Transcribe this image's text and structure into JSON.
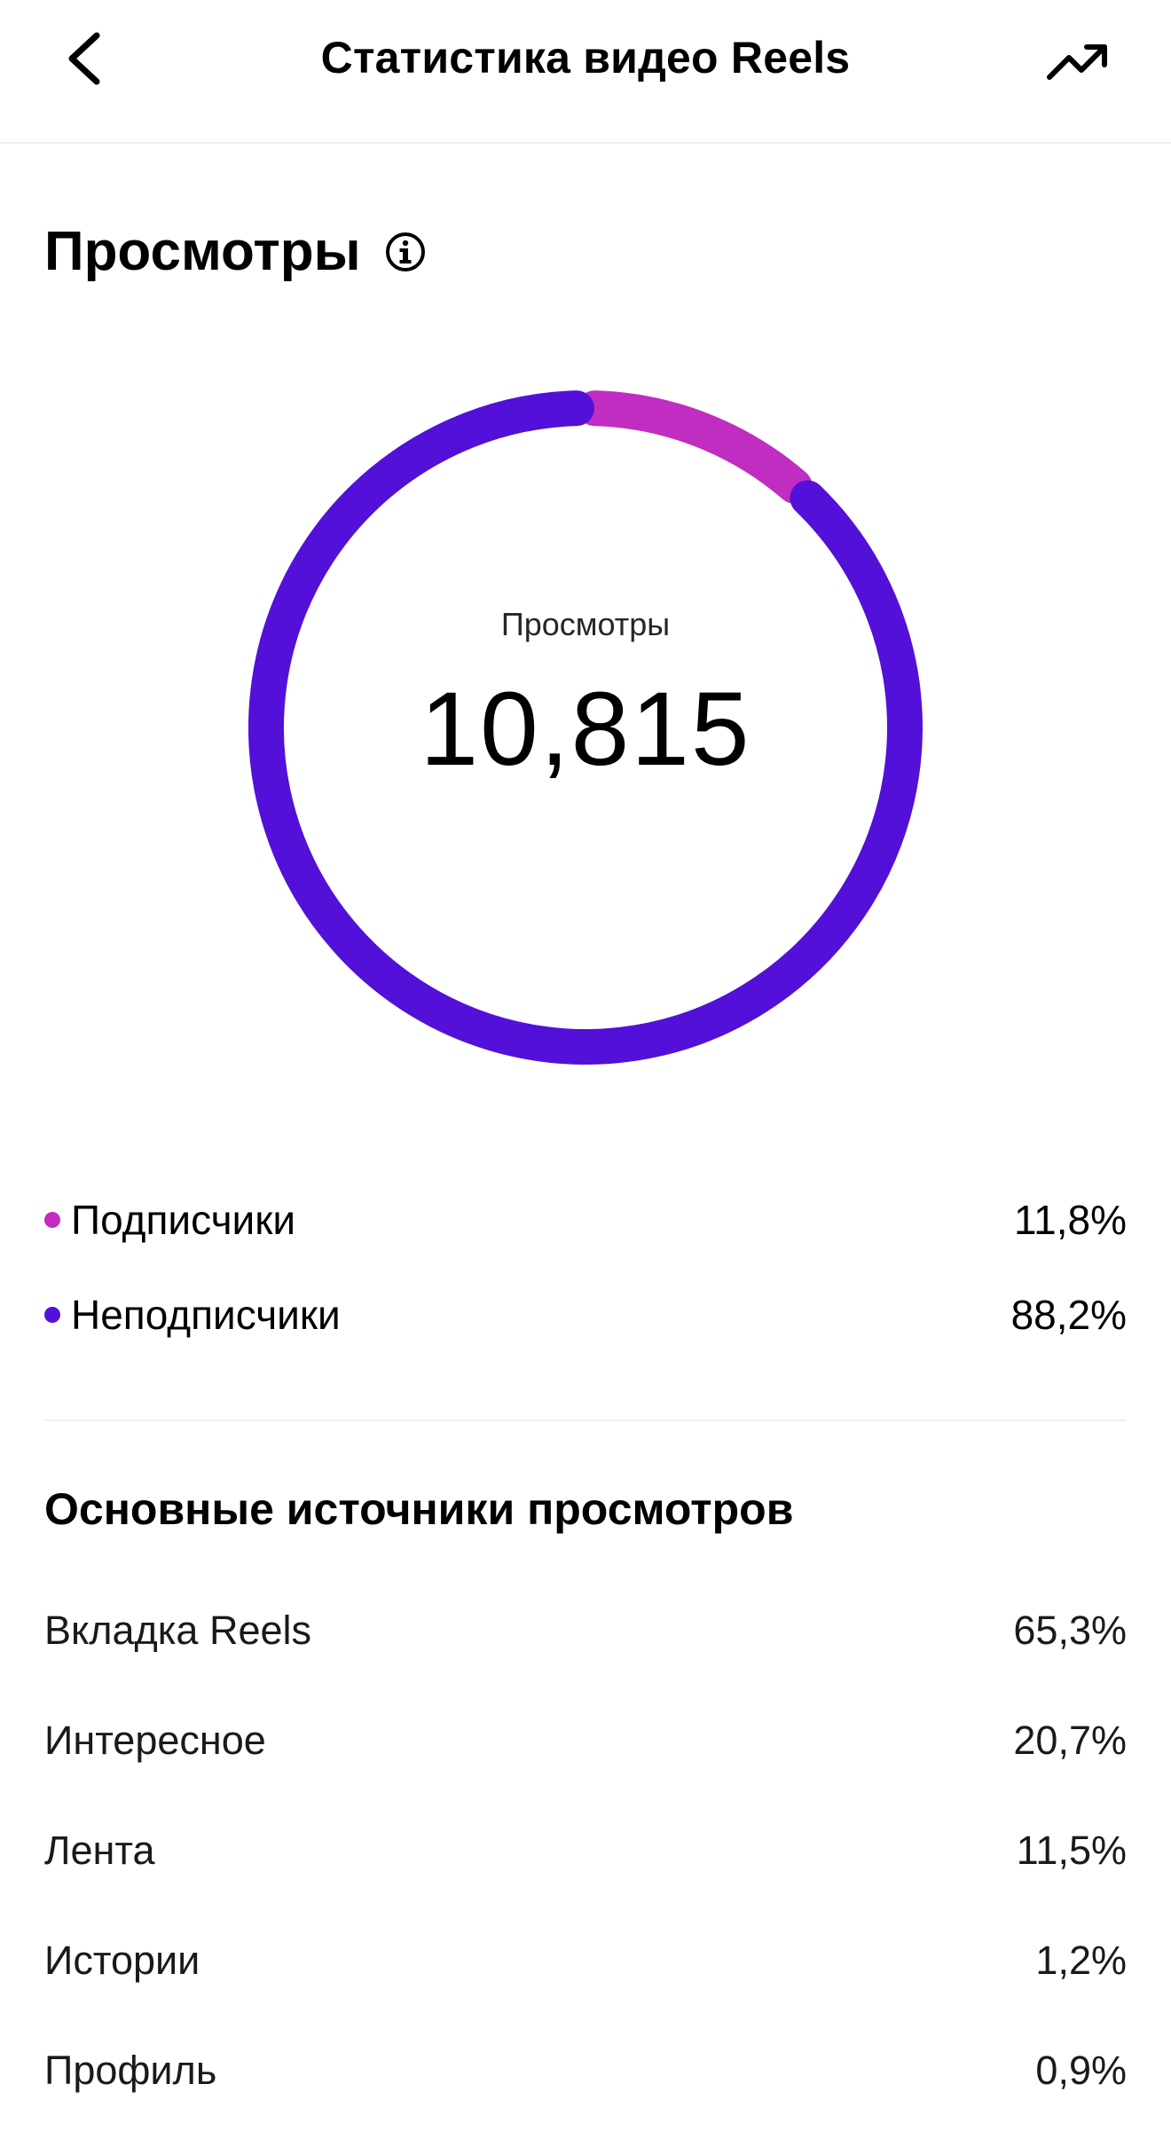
{
  "header": {
    "title": "Статистика видео Reels",
    "back_icon": "chevron-left-icon",
    "trend_icon": "trending-up-icon"
  },
  "views_section": {
    "title": "Просмотры",
    "info_icon": "info-icon"
  },
  "chart_data": {
    "type": "pie",
    "style": "donut",
    "center_label": "Просмотры",
    "center_value": "10,815",
    "categories": [
      "Подписчики",
      "Неподписчики"
    ],
    "values": [
      11.8,
      88.2
    ],
    "colors": [
      "#c12cc1",
      "#5210d8"
    ],
    "start": "top",
    "direction": "clockwise"
  },
  "legend": [
    {
      "label": "Подписчики",
      "value": "11,8%",
      "color": "#c12cc1"
    },
    {
      "label": "Неподписчики",
      "value": "88,2%",
      "color": "#5210d8"
    }
  ],
  "sources": {
    "title": "Основные источники просмотров",
    "items": [
      {
        "label": "Вкладка Reels",
        "value": "65,3%"
      },
      {
        "label": "Интересное",
        "value": "20,7%"
      },
      {
        "label": "Лента",
        "value": "11,5%"
      },
      {
        "label": "Истории",
        "value": "1,2%"
      },
      {
        "label": "Профиль",
        "value": "0,9%"
      }
    ]
  }
}
